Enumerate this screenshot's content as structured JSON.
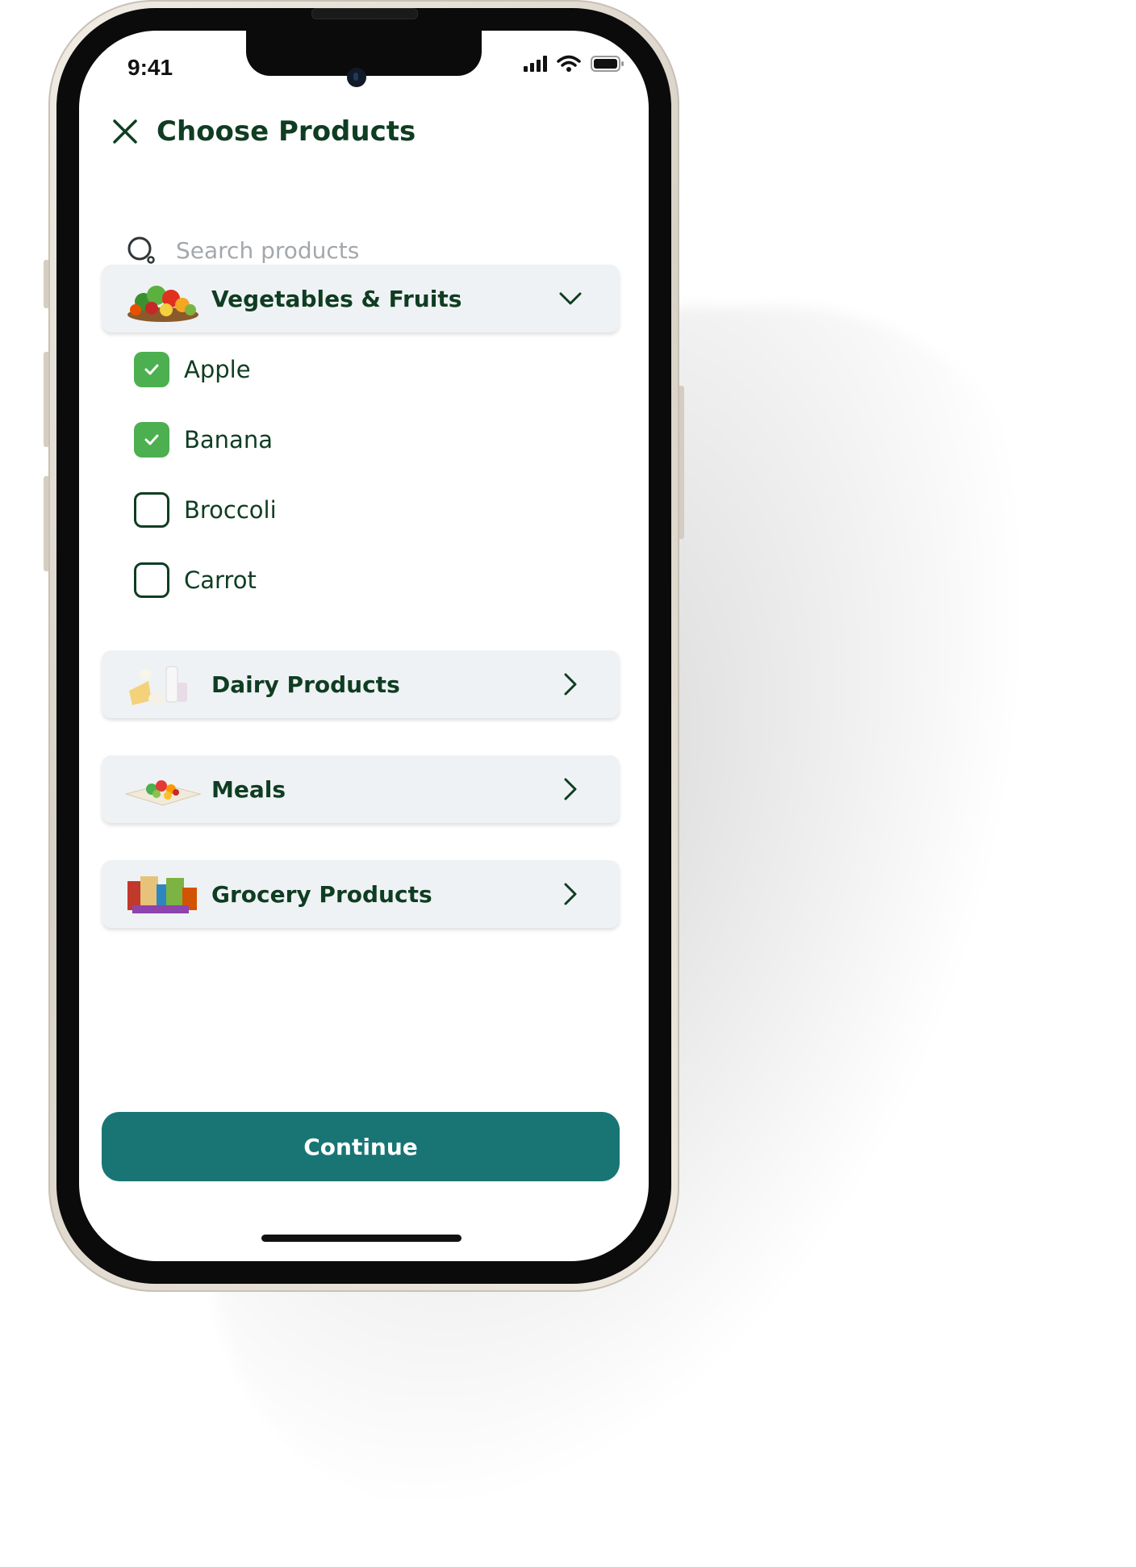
{
  "status_bar": {
    "time": "9:41"
  },
  "header": {
    "title": "Choose Products",
    "close_icon": "close-icon"
  },
  "search": {
    "placeholder": "Search products",
    "value": "",
    "icon": "search-icon"
  },
  "categories": [
    {
      "label": "Vegetables & Fruits",
      "state": "expanded",
      "chevron": "chevron-down-icon",
      "items": [
        {
          "label": "Apple",
          "checked": true
        },
        {
          "label": "Banana",
          "checked": true
        },
        {
          "label": "Broccoli",
          "checked": false
        },
        {
          "label": "Carrot",
          "checked": false
        }
      ]
    },
    {
      "label": "Dairy Products",
      "state": "collapsed",
      "chevron": "chevron-right-icon"
    },
    {
      "label": "Meals",
      "state": "collapsed",
      "chevron": "chevron-right-icon"
    },
    {
      "label": "Grocery Products",
      "state": "collapsed",
      "chevron": "chevron-right-icon"
    }
  ],
  "actions": {
    "continue_label": "Continue"
  },
  "colors": {
    "title": "#0f3d22",
    "checkbox_checked": "#4caf50",
    "category_background": "#eff2f4",
    "primary_button": "#187574"
  }
}
